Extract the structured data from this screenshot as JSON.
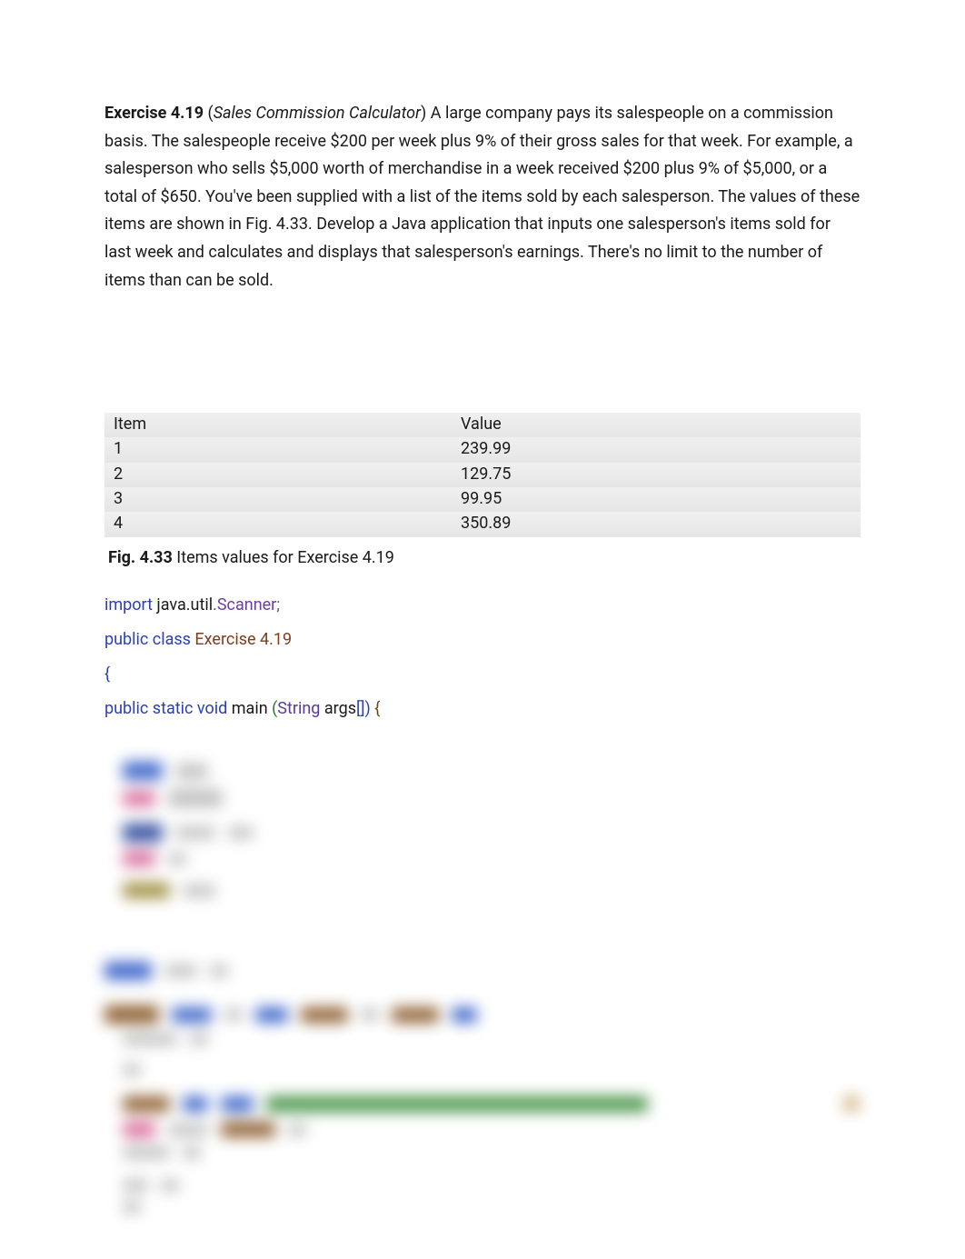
{
  "exercise": {
    "label": "Exercise 4.19",
    "subtitle": "Sales Commission Calculator",
    "body_after_title": ") A large company pays its salespeople on a commission basis. The salespeople receive $200 per week plus 9% of their gross sales for that week. For example, a salesperson who sells $5,000 worth of merchandise in a week received $200 plus 9% of $5,000, or a total of $650. You've been supplied with a list of the items sold by each salesperson. The values of these items are shown in Fig. 4.33. Develop a Java application that inputs one salesperson's items sold for last week and calculates and displays that salesperson's earnings. There's no limit to the number of items than can be sold."
  },
  "table": {
    "headers": {
      "item": "Item",
      "value": "Value"
    },
    "rows": [
      {
        "item": "1",
        "value": "239.99"
      },
      {
        "item": "2",
        "value": "129.75"
      },
      {
        "item": "3",
        "value": "99.95"
      },
      {
        "item": "4",
        "value": "350.89"
      }
    ]
  },
  "caption": {
    "label": "Fig. 4.33",
    "text": " Items values for Exercise 4.19"
  },
  "code": {
    "import": "import",
    "java": " java",
    "dot1": ".",
    "util": "util",
    "dot2": ".",
    "scanner": "Scanner",
    "semi": ";",
    "public": "public",
    "class_kw": " class",
    "class_name": " Exercise 4.19",
    "open_brace": "{",
    "public2": "public ",
    "static": "static ",
    "void": "void",
    "main": " main ",
    "lparen": "(",
    "string": "String",
    "args": " args",
    "brackets": "[]",
    "rparen": ")",
    "space": " ",
    "open_brace2": "{"
  }
}
